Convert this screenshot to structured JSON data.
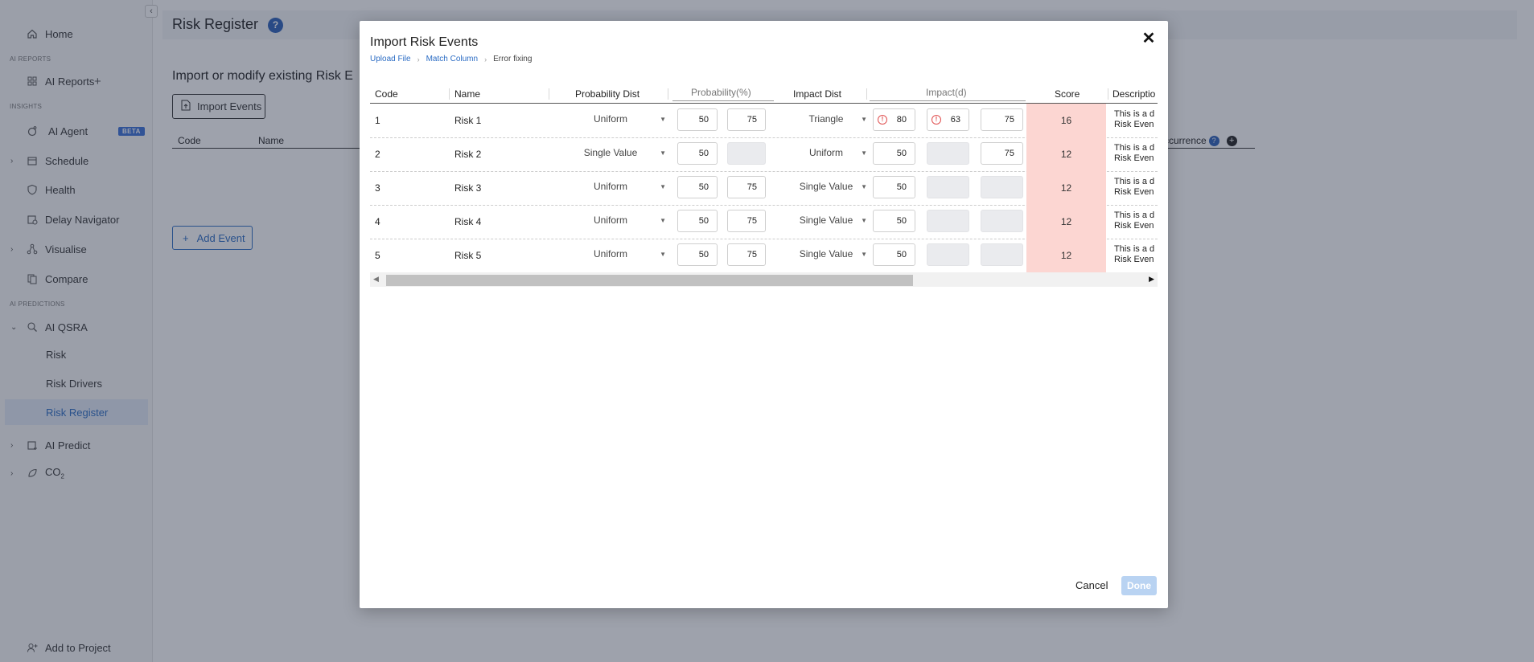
{
  "sidebar": {
    "home": "Home",
    "section_ai_reports": "AI REPORTS",
    "ai_reports": "AI Reports",
    "section_insights": "INSIGHTS",
    "ai_agent": "AI Agent",
    "beta": "BETA",
    "schedule": "Schedule",
    "health": "Health",
    "delay_navigator": "Delay Navigator",
    "visualise": "Visualise",
    "compare": "Compare",
    "section_ai_predictions": "AI PREDICTIONS",
    "ai_qsra": "AI QSRA",
    "risk": "Risk",
    "risk_drivers": "Risk Drivers",
    "risk_register": "Risk Register",
    "ai_predict": "AI Predict",
    "co2": "CO",
    "co2_sub": "2",
    "add_to_project": "Add to Project"
  },
  "page": {
    "title": "Risk Register",
    "help": "?",
    "subtitle": "Import or modify existing Risk E",
    "import_events": "Import Events",
    "col_code": "Code",
    "col_name": "Name",
    "col_occurrence": "ccurrence",
    "add_event": "Add Event"
  },
  "modal": {
    "title": "Import Risk Events",
    "breadcrumbs": [
      "Upload File",
      "Match Column",
      "Error fixing"
    ],
    "headers": {
      "code": "Code",
      "name": "Name",
      "probability_dist": "Probability Dist",
      "probability": "Probability(%)",
      "impact_dist": "Impact Dist",
      "impact": "Impact(d)",
      "score": "Score",
      "description": "Descriptio"
    },
    "rows": [
      {
        "code": "1",
        "name": "Risk 1",
        "prob_dist": "Uniform",
        "p1": "50",
        "p2": "75",
        "impact_dist": "Triangle",
        "i1": "80",
        "i2": "63",
        "i3": "75",
        "score": "16",
        "desc1": "This is a d",
        "desc2": "Risk Even"
      },
      {
        "code": "2",
        "name": "Risk 2",
        "prob_dist": "Single Value",
        "p1": "50",
        "p2": "",
        "impact_dist": "Uniform",
        "i1": "50",
        "i2": "",
        "i3": "75",
        "score": "12",
        "desc1": "This is a d",
        "desc2": "Risk Even"
      },
      {
        "code": "3",
        "name": "Risk 3",
        "prob_dist": "Uniform",
        "p1": "50",
        "p2": "75",
        "impact_dist": "Single Value",
        "i1": "50",
        "i2": "",
        "i3": "",
        "score": "12",
        "desc1": "This is a d",
        "desc2": "Risk Even"
      },
      {
        "code": "4",
        "name": "Risk 4",
        "prob_dist": "Uniform",
        "p1": "50",
        "p2": "75",
        "impact_dist": "Single Value",
        "i1": "50",
        "i2": "",
        "i3": "",
        "score": "12",
        "desc1": "This is a d",
        "desc2": "Risk Even"
      },
      {
        "code": "5",
        "name": "Risk 5",
        "prob_dist": "Uniform",
        "p1": "50",
        "p2": "75",
        "impact_dist": "Single Value",
        "i1": "50",
        "i2": "",
        "i3": "",
        "score": "12",
        "desc1": "This is a d",
        "desc2": "Risk Even"
      }
    ],
    "cancel": "Cancel",
    "done": "Done"
  },
  "colors": {
    "accent": "#2b6cc4",
    "score_bg": "#fcd6d2",
    "error": "#e05050",
    "done_disabled": "#b9d3f2"
  }
}
